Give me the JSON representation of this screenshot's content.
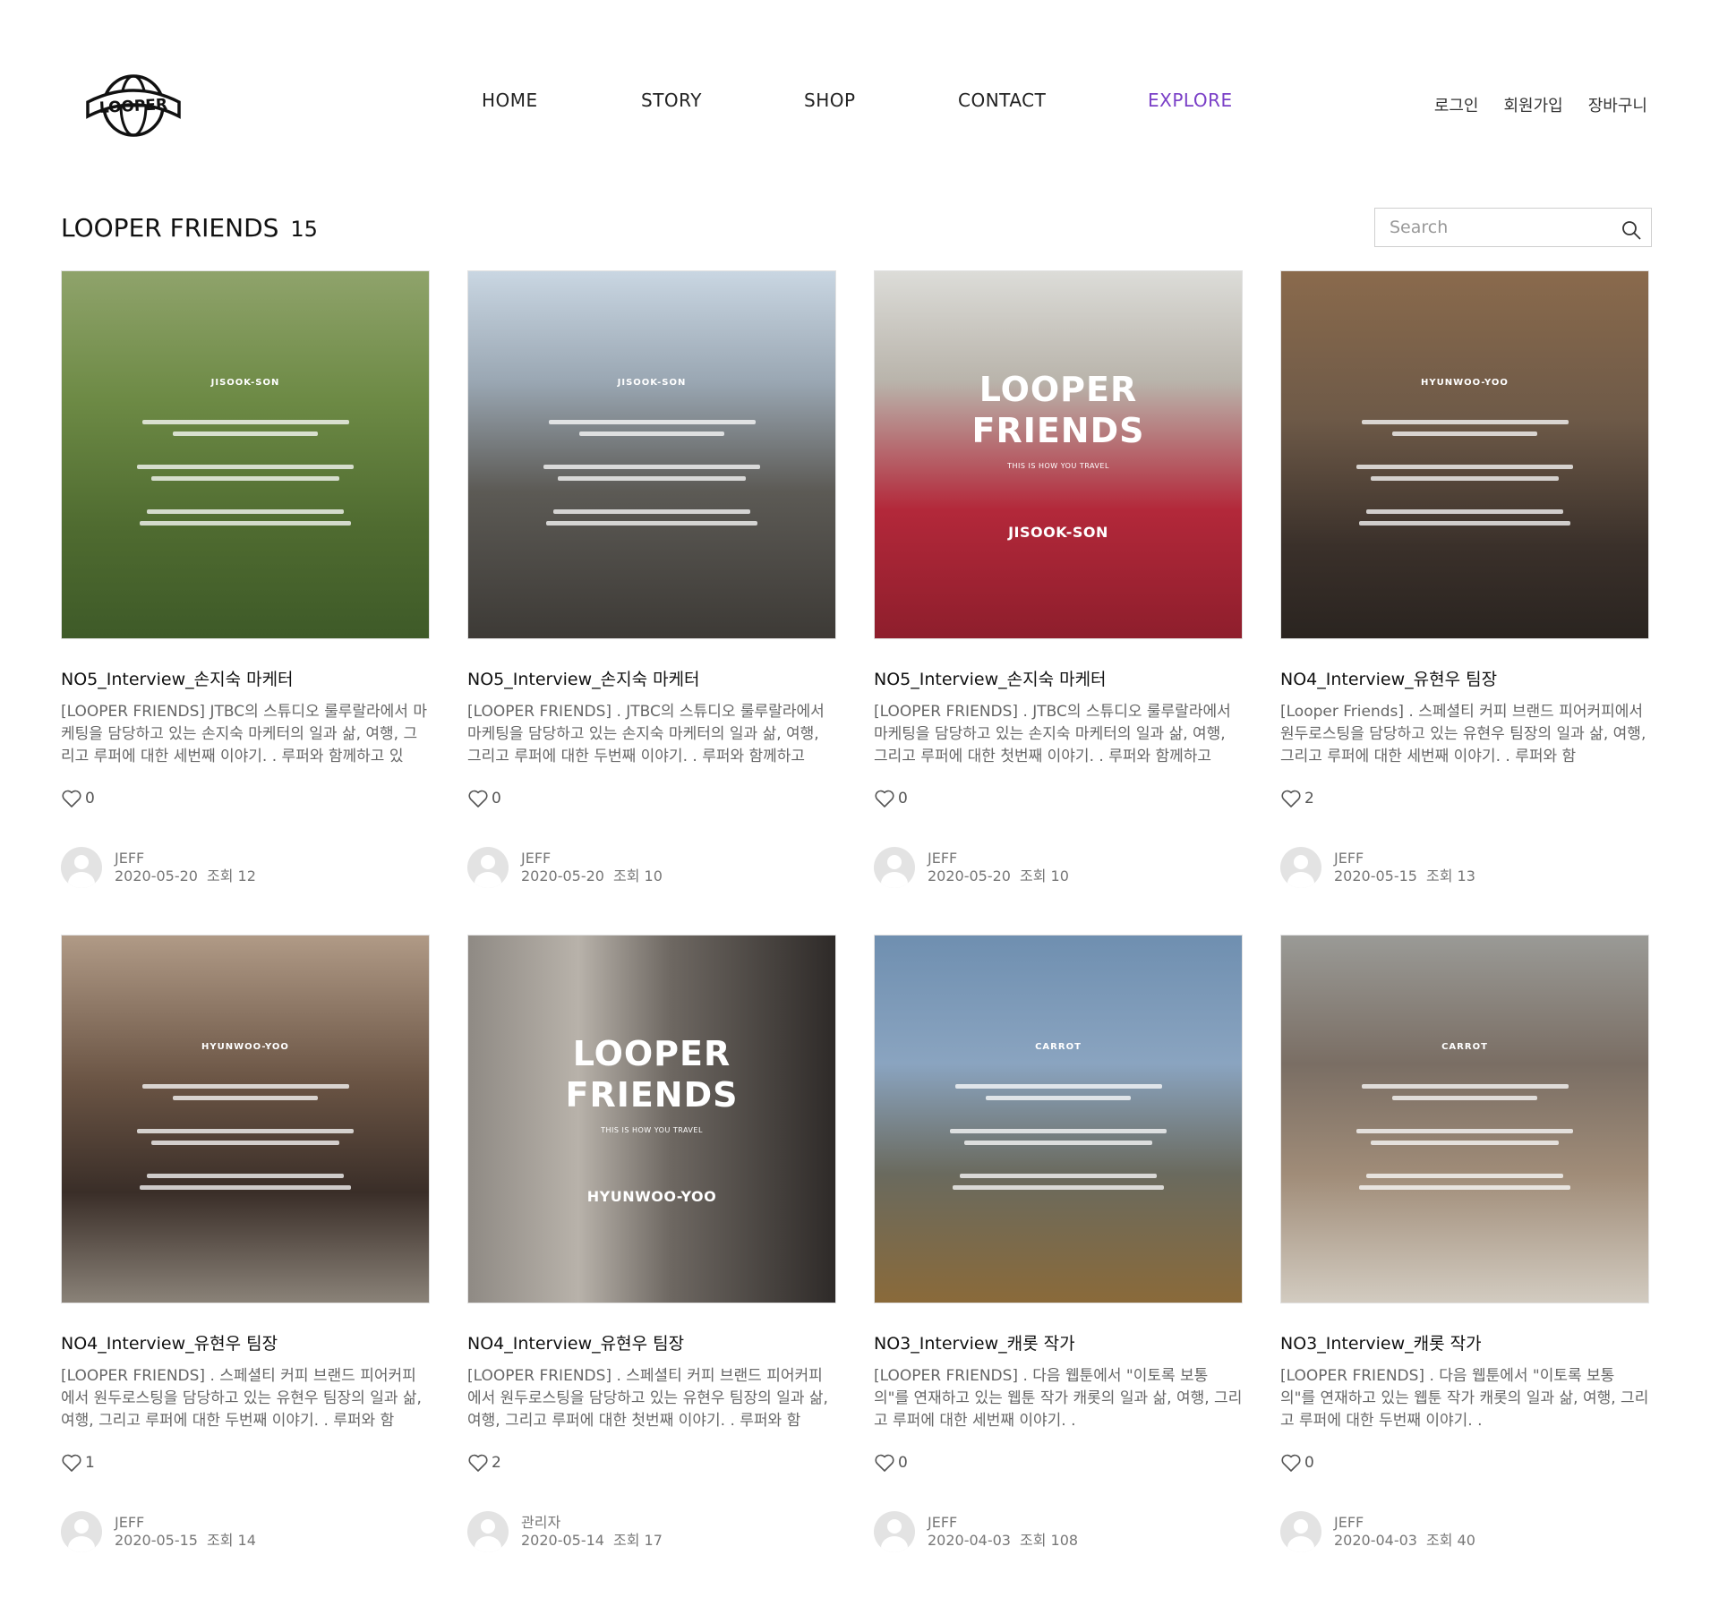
{
  "header": {
    "logo_text": "LOOPER",
    "nav": [
      "HOME",
      "STORY",
      "SHOP",
      "CONTACT",
      "EXPLORE"
    ],
    "active_nav": "EXPLORE",
    "user_links": {
      "login": "로그인",
      "signup": "회원가입",
      "cart": "장바구니"
    },
    "accent_color": "#7a3fc7"
  },
  "page": {
    "title": "LOOPER FRIENDS",
    "count": "15",
    "search_placeholder": "Search"
  },
  "posts": [
    {
      "title": "NO5_Interview_손지숙 마케터",
      "excerpt": "[LOOPER FRIENDS] JTBC의 스튜디오 룰루랄라에서 마케팅을 담당하고 있는 손지숙 마케터의 일과 삶, 여행, 그리고 루퍼에 대한 세번째 이야기. . 루퍼와 함께하고 있",
      "likes": "0",
      "author": "JEFF",
      "date": "2020-05-20",
      "views_label": "조회",
      "views": "12",
      "thumb": {
        "style": "text",
        "name": "JISOOK-SON",
        "bg": "linear-gradient(180deg,#8fa36b 0%,#6d8a45 35%,#4f6b30 70%,#3e5a28 100%)"
      }
    },
    {
      "title": "NO5_Interview_손지숙 마케터",
      "excerpt": "[LOOPER FRIENDS] . JTBC의 스튜디오 룰루랄라에서 마케팅을 담당하고 있는 손지숙 마케터의 일과 삶, 여행, 그리고 루퍼에 대한 두번째 이야기. . 루퍼와 함께하고",
      "likes": "0",
      "author": "JEFF",
      "date": "2020-05-20",
      "views_label": "조회",
      "views": "10",
      "thumb": {
        "style": "text",
        "name": "JISOOK-SON",
        "bg": "linear-gradient(180deg,#c9d6e2 0%,#9aa7b3 30%,#5c5a55 60%,#3d3a36 100%)"
      }
    },
    {
      "title": "NO5_Interview_손지숙 마케터",
      "excerpt": "[LOOPER FRIENDS] . JTBC의 스튜디오 룰루랄라에서 마케팅을 담당하고 있는 손지숙 마케터의 일과 삶, 여행, 그리고 루퍼에 대한 첫번째 이야기. . 루퍼와 함께하고",
      "likes": "0",
      "author": "JEFF",
      "date": "2020-05-20",
      "views_label": "조회",
      "views": "10",
      "thumb": {
        "style": "cover",
        "logo1": "LOOPER",
        "logo2": "FRIENDS",
        "tagline": "THIS IS HOW YOU TRAVEL",
        "name": "JISOOK-SON",
        "bg": "linear-gradient(180deg,#dcdcd8 0%,#b9b4ab 30%,#b3283a 65%,#8e1e2c 100%)"
      }
    },
    {
      "title": "NO4_Interview_유현우 팀장",
      "excerpt": "[Looper Friends] . 스페셜티 커피 브랜드 피어커피에서 원두로스팅을 담당하고 있는 유현우 팀장의 일과 삶, 여행, 그리고 루퍼에 대한 세번째 이야기. . 루퍼와 함",
      "likes": "2",
      "author": "JEFF",
      "date": "2020-05-15",
      "views_label": "조회",
      "views": "13",
      "thumb": {
        "style": "text",
        "name": "HYUNWOO-YOO",
        "bg": "linear-gradient(180deg,#8a6a4c 0%,#6e5a48 40%,#3a302a 75%,#2a2420 100%)"
      }
    },
    {
      "title": "NO4_Interview_유현우 팀장",
      "excerpt": "[LOOPER FRIENDS] . 스페셜티 커피 브랜드 피어커피에서 원두로스팅을 담당하고 있는 유현우 팀장의 일과 삶, 여행, 그리고 루퍼에 대한 두번째 이야기. . 루퍼와 함",
      "likes": "1",
      "author": "JEFF",
      "date": "2020-05-15",
      "views_label": "조회",
      "views": "14",
      "thumb": {
        "style": "text",
        "name": "HYUNWOO-YOO",
        "bg": "linear-gradient(180deg,#b09a86 0%,#6a5444 40%,#3a2e28 70%,#8a8278 100%)"
      }
    },
    {
      "title": "NO4_Interview_유현우 팀장",
      "excerpt": "[LOOPER FRIENDS] . 스페셜티 커피 브랜드 피어커피에서 원두로스팅을 담당하고 있는 유현우 팀장의 일과 삶, 여행, 그리고 루퍼에 대한 첫번째 이야기. . 루퍼와 함",
      "likes": "2",
      "author": "관리자",
      "date": "2020-05-14",
      "views_label": "조회",
      "views": "17",
      "thumb": {
        "style": "cover",
        "logo1": "LOOPER",
        "logo2": "FRIENDS",
        "tagline": "THIS IS HOW YOU TRAVEL",
        "name": "HYUNWOO-YOO",
        "bg": "linear-gradient(90deg,#8f8a84 0%,#b8b2aa 30%,#6e6862 55%,#2e2a28 100%)"
      }
    },
    {
      "title": "NO3_Interview_캐롯 작가",
      "excerpt": "[LOOPER FRIENDS] . 다음 웹툰에서 \"이토록 보통의\"를 연재하고 있는 웹툰 작가 캐롯의 일과 삶, 여행, 그리고 루퍼에 대한 세번째 이야기. .",
      "likes": "0",
      "author": "JEFF",
      "date": "2020-04-03",
      "views_label": "조회",
      "views": "108",
      "thumb": {
        "style": "text",
        "name": "CARROT",
        "bg": "linear-gradient(180deg,#6f8fb0 0%,#8aa4c0 35%,#6a6a5e 65%,#8a6a3a 100%)"
      }
    },
    {
      "title": "NO3_Interview_캐롯 작가",
      "excerpt": "[LOOPER FRIENDS] . 다음 웹툰에서 \"이토록 보통의\"를 연재하고 있는 웹툰 작가 캐롯의 일과 삶, 여행, 그리고 루퍼에 대한 두번째 이야기. .",
      "likes": "0",
      "author": "JEFF",
      "date": "2020-04-03",
      "views_label": "조회",
      "views": "40",
      "thumb": {
        "style": "text",
        "name": "CARROT",
        "bg": "linear-gradient(180deg,#9a9a96 0%,#7a6e64 35%,#a08c78 65%,#d2cbc0 100%)"
      }
    }
  ]
}
